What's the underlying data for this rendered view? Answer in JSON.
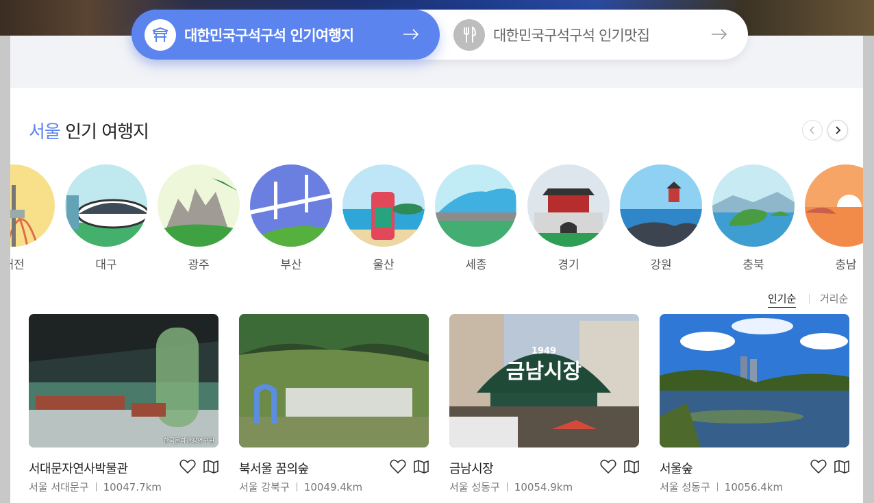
{
  "tabs": [
    {
      "label": "대한민국구석구석 인기여행지",
      "icon": "gate-icon",
      "active": true
    },
    {
      "label": "대한민국구석구석 인기맛집",
      "icon": "utensils-icon",
      "active": false
    }
  ],
  "section": {
    "highlight": "서울",
    "title": "인기 여행지"
  },
  "regions": [
    "대전",
    "대구",
    "광주",
    "부산",
    "울산",
    "세종",
    "경기",
    "강원",
    "충북",
    "충남"
  ],
  "sort": {
    "popular": "인기순",
    "distance": "거리순"
  },
  "cards": [
    {
      "title": "서대문자연사박물관",
      "location": "서울 서대문구",
      "distance": "10047.7km",
      "credit": "한국문화관광연구원"
    },
    {
      "title": "북서울 꿈의숲",
      "location": "서울 강북구",
      "distance": "10049.4km"
    },
    {
      "title": "금남시장",
      "location": "서울 성동구",
      "distance": "10054.9km",
      "sign_year": "1949",
      "sign": "금남시장"
    },
    {
      "title": "서울숲",
      "location": "서울 성동구",
      "distance": "10056.4km"
    }
  ],
  "colors": {
    "accent": "#5b84ef",
    "inactive_icon": "#bdbdbd"
  }
}
